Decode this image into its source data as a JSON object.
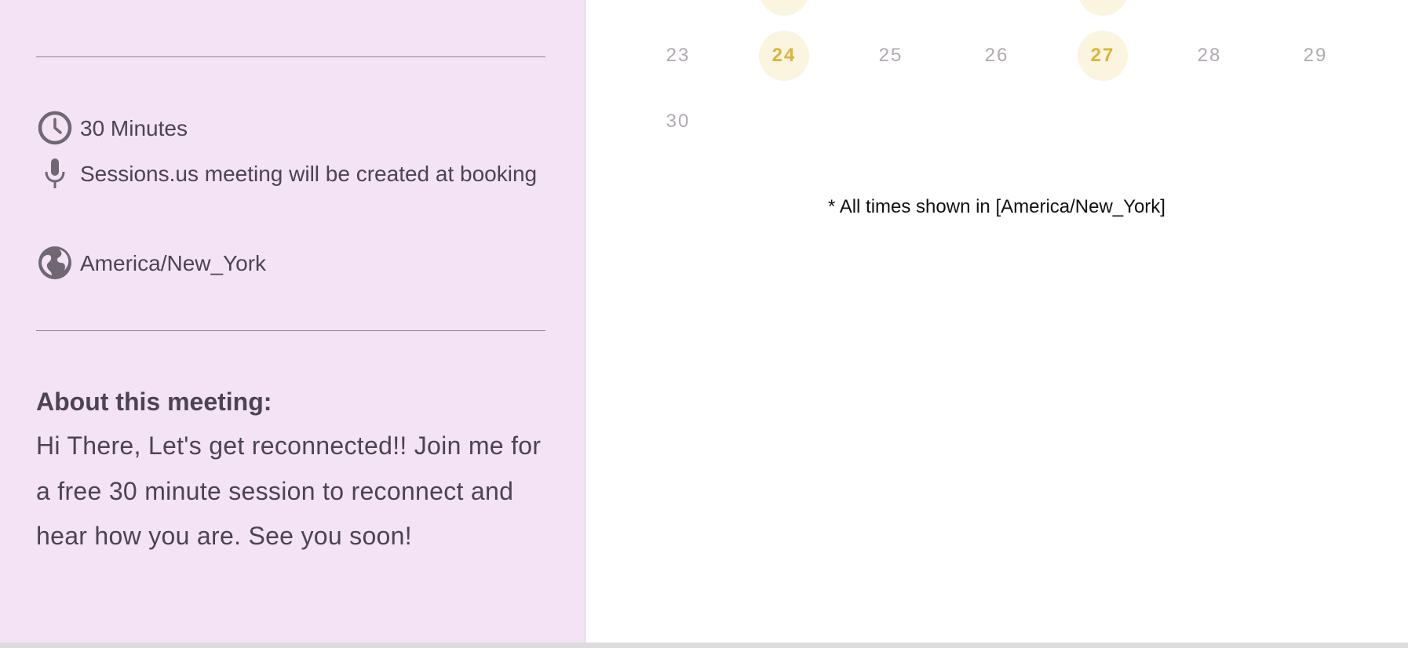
{
  "sidebar": {
    "details": {
      "duration": "30 Minutes",
      "duration_icon": "clock-icon",
      "location": "Sessions.us meeting will be created at booking",
      "location_icon": "microphone-icon",
      "timezone": "America/New_York",
      "timezone_icon": "globe-icon"
    },
    "about": {
      "title": "About this meeting:",
      "body": "Hi There, Let's get reconnected!! Join me for a free 30 minute session to reconnect and hear how you are. See you soon!"
    }
  },
  "calendar": {
    "week_rows": [
      {
        "days": [
          {
            "label": "",
            "available": false
          },
          {
            "label": "",
            "available": true
          },
          {
            "label": "",
            "available": false
          },
          {
            "label": "",
            "available": false
          },
          {
            "label": "",
            "available": true
          },
          {
            "label": "",
            "available": false
          },
          {
            "label": "",
            "available": false
          }
        ]
      },
      {
        "days": [
          {
            "label": "23",
            "available": false
          },
          {
            "label": "24",
            "available": true
          },
          {
            "label": "25",
            "available": false
          },
          {
            "label": "26",
            "available": false
          },
          {
            "label": "27",
            "available": true
          },
          {
            "label": "28",
            "available": false
          },
          {
            "label": "29",
            "available": false
          }
        ]
      },
      {
        "days": [
          {
            "label": "30",
            "available": false
          }
        ]
      }
    ],
    "timezone_note": "* All times shown in [America/New_York]"
  },
  "colors": {
    "sidebar_bg": "#f4e3f5",
    "text": "#4b4452",
    "available_bg": "#fbf4df",
    "available_text": "#dcb43c",
    "unavailable_text": "#b0aab0"
  }
}
